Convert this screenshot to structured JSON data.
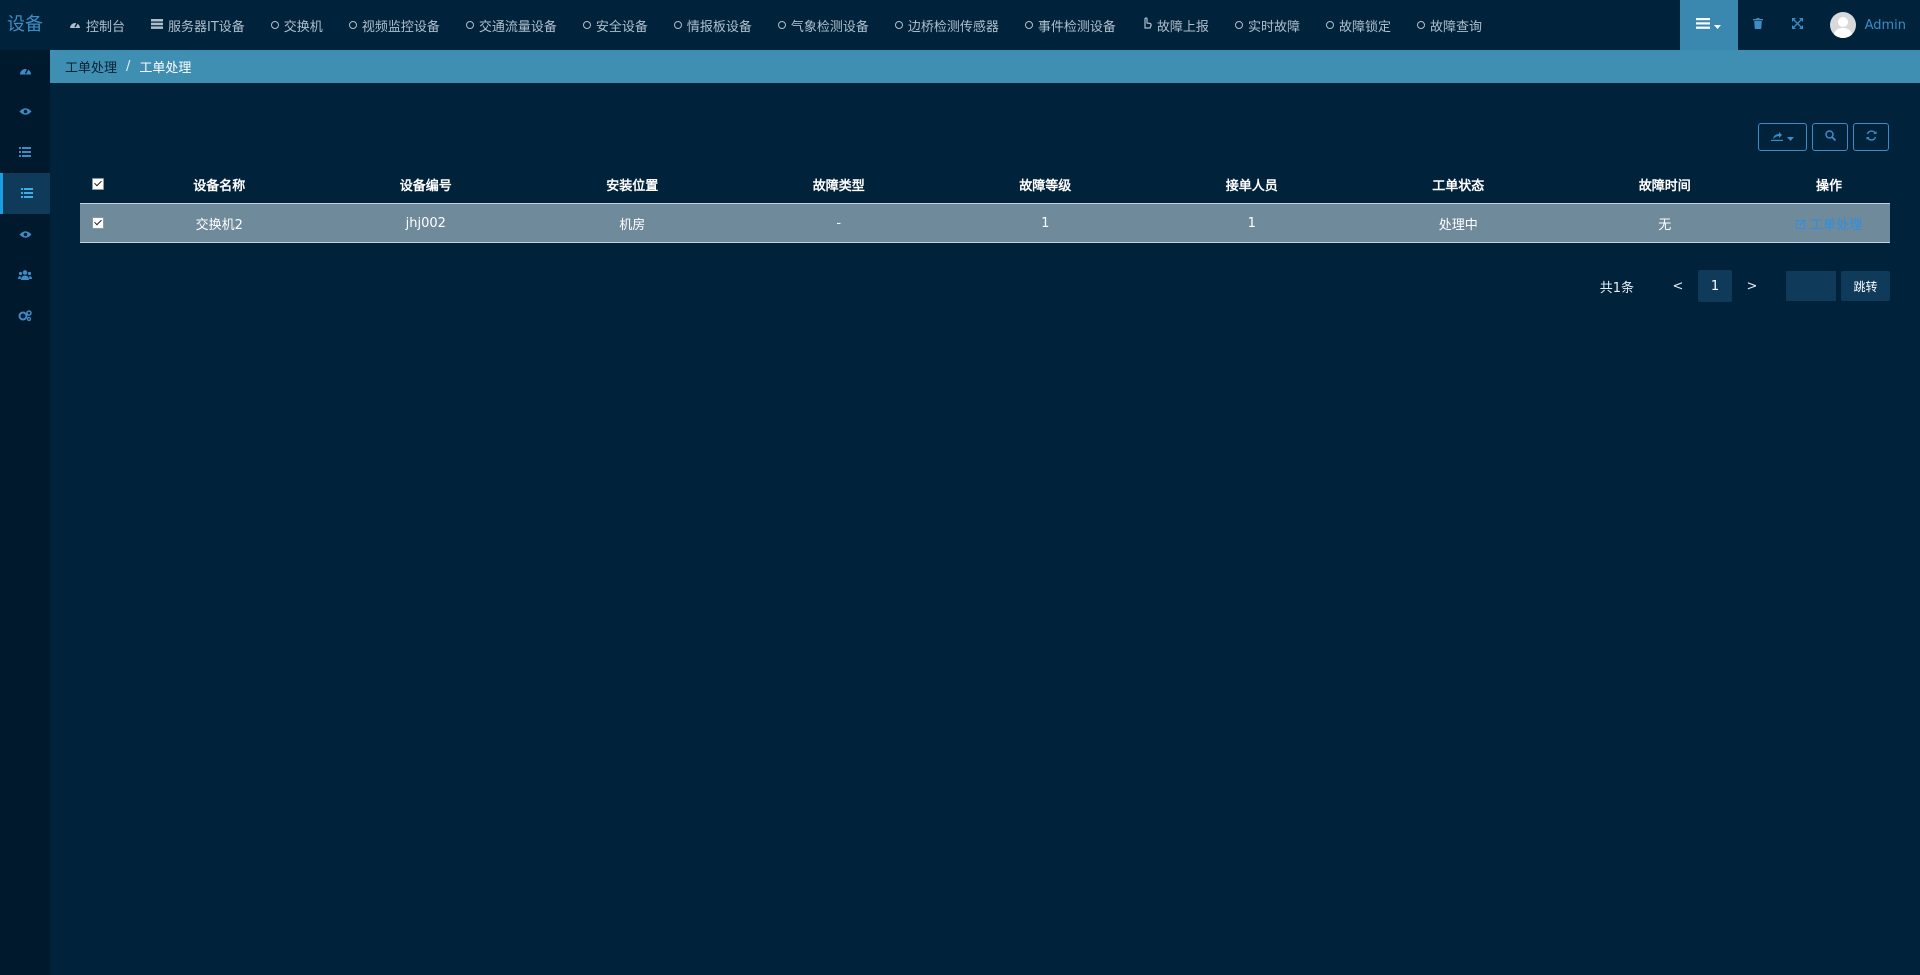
{
  "app": {
    "logo_text": "设备"
  },
  "topnav": {
    "items": [
      {
        "label": "控制台",
        "icon": "dashboard-icon"
      },
      {
        "label": "服务器IT设备",
        "icon": "server-icon"
      },
      {
        "label": "交换机",
        "icon": "circle-icon"
      },
      {
        "label": "视频监控设备",
        "icon": "circle-icon"
      },
      {
        "label": "交通流量设备",
        "icon": "circle-icon"
      },
      {
        "label": "安全设备",
        "icon": "circle-icon"
      },
      {
        "label": "情报板设备",
        "icon": "circle-icon"
      },
      {
        "label": "气象检测设备",
        "icon": "circle-icon"
      },
      {
        "label": "边桥检测传感器",
        "icon": "circle-icon"
      },
      {
        "label": "事件检测设备",
        "icon": "circle-icon"
      },
      {
        "label": "故障上报",
        "icon": "hand-pointer-icon"
      },
      {
        "label": "实时故障",
        "icon": "circle-icon"
      },
      {
        "label": "故障锁定",
        "icon": "circle-icon"
      },
      {
        "label": "故障查询",
        "icon": "circle-icon"
      }
    ]
  },
  "user": {
    "name": "Admin"
  },
  "sidebar": {
    "items": [
      {
        "icon": "dashboard-icon",
        "active": false
      },
      {
        "icon": "eye-icon",
        "active": false
      },
      {
        "icon": "list-icon",
        "active": false
      },
      {
        "icon": "list-icon",
        "active": true
      },
      {
        "icon": "eye-icon",
        "active": false
      },
      {
        "icon": "users-icon",
        "active": false
      },
      {
        "icon": "cogs-icon",
        "active": false
      }
    ]
  },
  "breadcrumb": {
    "parent": "工单处理",
    "separator": "/",
    "current": "工单处理"
  },
  "table": {
    "columns": [
      "设备名称",
      "设备编号",
      "安装位置",
      "故障类型",
      "故障等级",
      "接单人员",
      "工单状态",
      "故障时间",
      "操作"
    ],
    "rows": [
      {
        "cells": [
          "交换机2",
          "jhj002",
          "机房",
          "-",
          "1",
          "1",
          "处理中",
          "无"
        ],
        "action": "工单处理"
      }
    ]
  },
  "pagination": {
    "total": "共1条",
    "prev": "<",
    "next": ">",
    "current": "1",
    "go_label": "跳转"
  },
  "colors": {
    "background": "#00223b",
    "sidebar": "#00192d",
    "breadcrumb": "#3f8fb3",
    "accent": "#3d8cc5",
    "row": "#6f8a9b"
  }
}
